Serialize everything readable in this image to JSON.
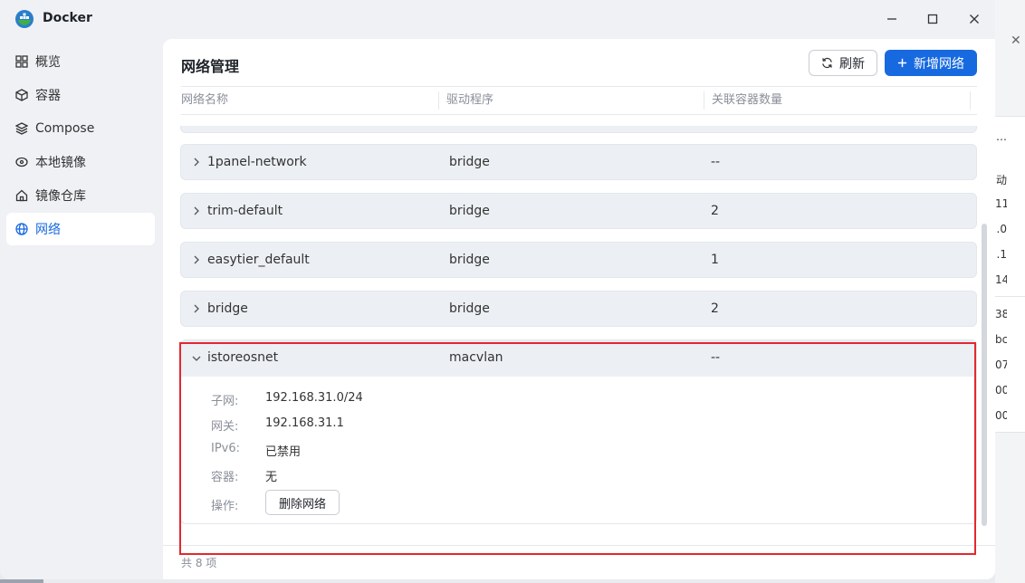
{
  "app": {
    "title": "Docker"
  },
  "sidebar": {
    "items": [
      {
        "label": "概览",
        "icon": "grid-icon",
        "active": false
      },
      {
        "label": "容器",
        "icon": "cube-icon",
        "active": false
      },
      {
        "label": "Compose",
        "icon": "layers-icon",
        "active": false
      },
      {
        "label": "本地镜像",
        "icon": "disk-icon",
        "active": false
      },
      {
        "label": "镜像仓库",
        "icon": "home-icon",
        "active": false
      },
      {
        "label": "网络",
        "icon": "globe-icon",
        "active": true
      }
    ]
  },
  "main": {
    "title": "网络管理",
    "refresh_label": "刷新",
    "add_label": "新增网络",
    "columns": [
      "网络名称",
      "驱动程序",
      "关联容器数量"
    ],
    "rows": [
      {
        "name": "1panel-network",
        "driver": "bridge",
        "count": "--"
      },
      {
        "name": "trim-default",
        "driver": "bridge",
        "count": "2"
      },
      {
        "name": "easytier_default",
        "driver": "bridge",
        "count": "1"
      },
      {
        "name": "bridge",
        "driver": "bridge",
        "count": "2"
      }
    ],
    "expanded": {
      "name": "istoreosnet",
      "driver": "macvlan",
      "count": "--",
      "details": {
        "subnet_label": "子网:",
        "subnet": "192.168.31.0/24",
        "gateway_label": "网关:",
        "gateway": "192.168.31.1",
        "ipv6_label": "IPv6:",
        "ipv6": "已禁用",
        "containers_label": "容器:",
        "containers": "无",
        "actions_label": "操作:",
        "delete_label": "删除网络"
      }
    },
    "footer": "共 8 项"
  },
  "background_window": {
    "fragments": [
      "…",
      "动",
      "11",
      ".0",
      ".1",
      "14",
      "38",
      "bc",
      "07",
      "00",
      "00"
    ]
  },
  "colors": {
    "accent": "#1769e0",
    "highlight": "#e3282e",
    "row_bg": "#eceff4"
  }
}
